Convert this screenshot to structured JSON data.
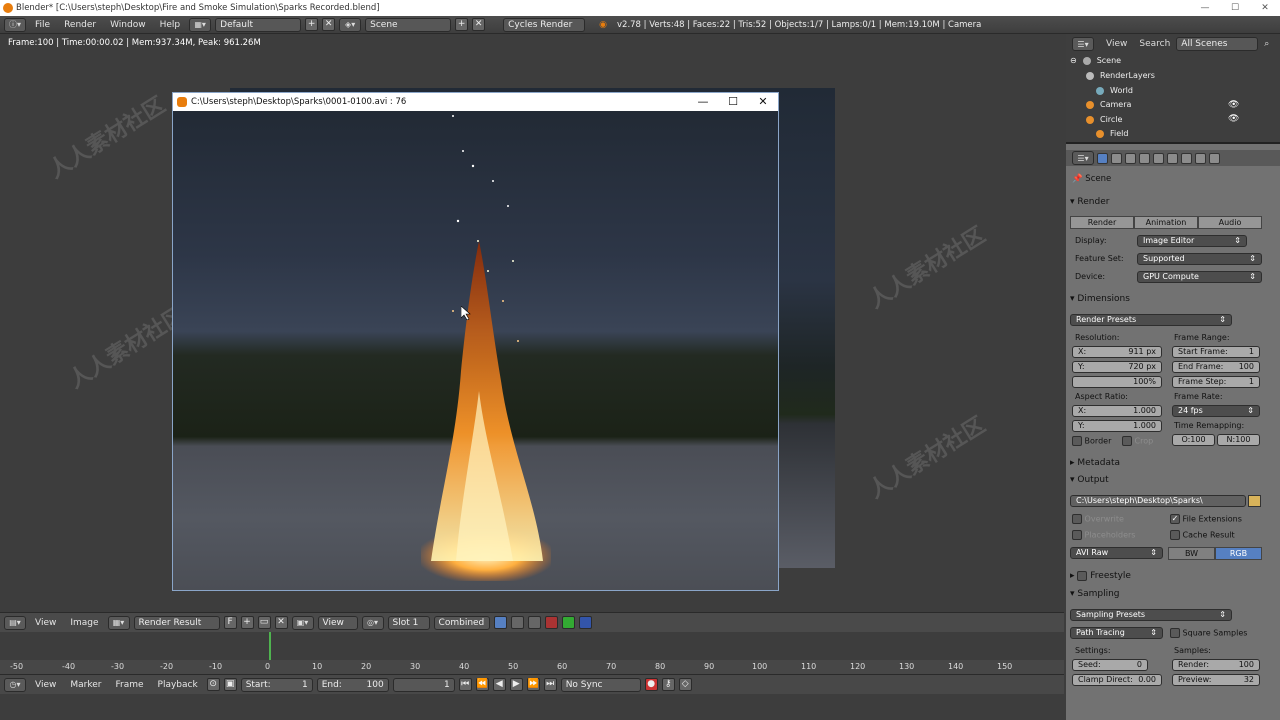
{
  "window": {
    "title": "Blender* [C:\\Users\\steph\\Desktop\\Fire and Smoke Simulation\\Sparks Recorded.blend]"
  },
  "menu": {
    "items": [
      "File",
      "Render",
      "Window",
      "Help"
    ],
    "screen_layout": "Default",
    "scene": "Scene",
    "engine": "Cycles Render"
  },
  "stats": "v2.78 | Verts:48 | Faces:22 | Tris:52 | Objects:1/7 | Lamps:0/1 | Mem:19.10M | Camera",
  "viewport": {
    "info": "Frame:100 | Time:00:00.02 | Mem:937.34M, Peak: 961.26M"
  },
  "render_window": {
    "title": "C:\\Users\\steph\\Desktop\\Sparks\\0001-0100.avi :  76"
  },
  "outliner": {
    "view_label": "View",
    "search_label": "Search",
    "filter": "All Scenes",
    "items": [
      "Scene",
      "RenderLayers",
      "World",
      "Camera",
      "Circle",
      "Field"
    ]
  },
  "properties": {
    "scene_label": "Scene",
    "render_panel": "Render",
    "render_buttons": [
      "Render",
      "Animation",
      "Audio"
    ],
    "display_label": "Display:",
    "display_value": "Image Editor",
    "featureset_label": "Feature Set:",
    "featureset_value": "Supported",
    "device_label": "Device:",
    "device_value": "GPU Compute",
    "dimensions_panel": "Dimensions",
    "render_presets": "Render Presets",
    "resolution_label": "Resolution:",
    "res_x_label": "X:",
    "res_x": "911 px",
    "res_y_label": "Y:",
    "res_y": "720 px",
    "res_pct": "100%",
    "frame_range_label": "Frame Range:",
    "start_frame_label": "Start Frame:",
    "start_frame": "1",
    "end_frame_label": "End Frame:",
    "end_frame": "100",
    "frame_step_label": "Frame Step:",
    "frame_step": "1",
    "aspect_label": "Aspect Ratio:",
    "aspect_x_label": "X:",
    "aspect_x": "1.000",
    "aspect_y_label": "Y:",
    "aspect_y": "1.000",
    "frame_rate_label": "Frame Rate:",
    "frame_rate": "24 fps",
    "time_remap_label": "Time Remapping:",
    "border_label": "Border",
    "crop_label": "Crop",
    "remap_old": "O:100",
    "remap_new": "N:100",
    "metadata_panel": "Metadata",
    "output_panel": "Output",
    "output_path": "C:\\Users\\steph\\Desktop\\Sparks\\",
    "overwrite_label": "Overwrite",
    "file_ext_label": "File Extensions",
    "placeholders_label": "Placeholders",
    "cache_result_label": "Cache Result",
    "format": "AVI Raw",
    "bw_label": "BW",
    "rgb_label": "RGB",
    "freestyle_panel": "Freestyle",
    "sampling_panel": "Sampling",
    "sampling_presets": "Sampling Presets",
    "integrator": "Path Tracing",
    "square_samples_label": "Square Samples",
    "settings_label": "Settings:",
    "samples_label": "Samples:",
    "seed_label": "Seed:",
    "seed": "0",
    "render_samples_label": "Render:",
    "render_samples": "100",
    "clamp_label": "Clamp Direct:",
    "clamp": "0.00",
    "preview_label": "Preview:",
    "preview": "32"
  },
  "image_editor": {
    "view": "View",
    "image": "Image",
    "render_result": "Render Result",
    "f_label": "F",
    "view2": "View",
    "slot": "Slot 1",
    "pass": "Combined"
  },
  "timeline": {
    "ticks": [
      "-50",
      "-40",
      "-30",
      "-20",
      "-10",
      "0",
      "10",
      "20",
      "30",
      "40",
      "50",
      "60",
      "70",
      "80",
      "90",
      "100",
      "110",
      "120",
      "130",
      "140",
      "150"
    ],
    "view": "View",
    "marker": "Marker",
    "frame": "Frame",
    "playback": "Playback",
    "start_label": "Start:",
    "start": "1",
    "end_label": "End:",
    "end": "100",
    "current": "1",
    "sync": "No Sync"
  }
}
